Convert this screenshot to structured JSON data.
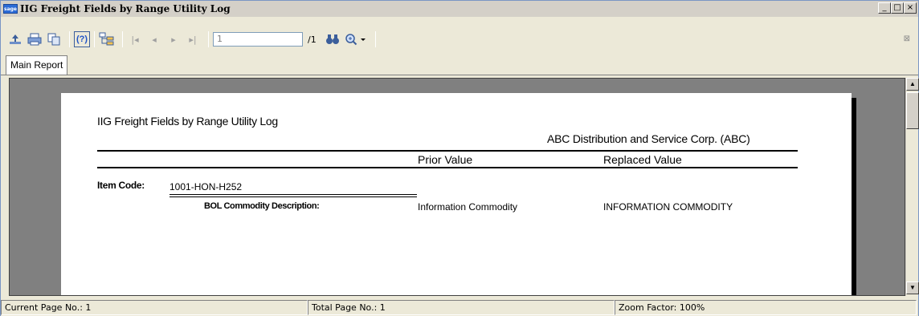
{
  "window": {
    "logo": "sage",
    "title": "IIG Freight Fields by Range Utility Log",
    "minimize": "_",
    "restore": "□",
    "close": "×"
  },
  "toolbar": {
    "page_input_value": "1",
    "page_total": "/1",
    "close_glyph": "⊠"
  },
  "tabs": [
    {
      "label": "Main Report"
    }
  ],
  "report": {
    "title": "IIG Freight Fields by Range Utility Log",
    "company": "ABC Distribution and Service Corp. (ABC)",
    "columns": {
      "prior": "Prior Value",
      "replaced": "Replaced Value"
    },
    "item_label": "Item Code:",
    "item_value": "1001-HON-H252",
    "rows": [
      {
        "field": "BOL Commodity Description:",
        "prior": "Information Commodity",
        "replaced": "INFORMATION COMMODITY"
      }
    ]
  },
  "status": {
    "current_page": "Current Page No.: 1",
    "total_page": "Total Page No.: 1",
    "zoom": "Zoom Factor: 100%"
  }
}
